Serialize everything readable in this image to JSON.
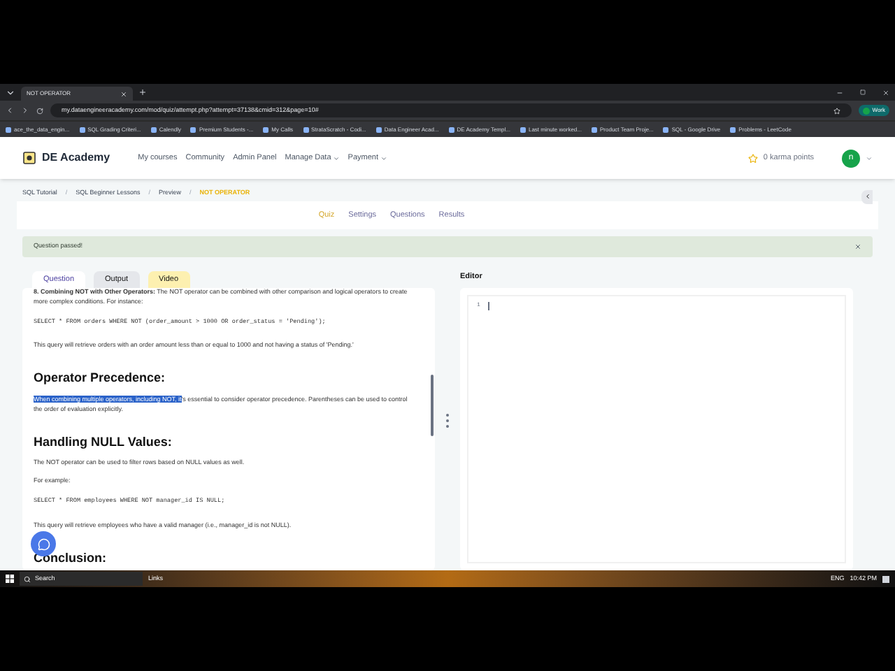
{
  "browser": {
    "tab_title": "NOT OPERATOR",
    "url": "my.dataengineeracademy.com/mod/quiz/attempt.php?attempt=37138&cmid=312&page=10#",
    "profile": "Work",
    "bookmarks": [
      "ace_the_data_engin...",
      "SQL Grading Criteri...",
      "Calendly",
      "Premium Students -...",
      "My Calls",
      "StrataScratch - Codi...",
      "Data Engineer Acad...",
      "DE Academy Templ...",
      "Last minute worked...",
      "Product Team Proje...",
      "SQL - Google Drive",
      "Problems - LeetCode"
    ]
  },
  "header": {
    "logo": "DE Academy",
    "nav": [
      {
        "label": "My courses",
        "menu": false
      },
      {
        "label": "Community",
        "menu": false
      },
      {
        "label": "Admin Panel",
        "menu": false
      },
      {
        "label": "Manage Data",
        "menu": true
      },
      {
        "label": "Payment",
        "menu": true
      }
    ],
    "karma": "0 karma points",
    "avatar": "n"
  },
  "breadcrumb": {
    "separator": "/",
    "items": [
      {
        "label": "SQL Tutorial",
        "current": false
      },
      {
        "label": "SQL Beginner Lessons",
        "current": false
      },
      {
        "label": "Preview",
        "current": false
      },
      {
        "label": "NOT OPERATOR",
        "current": true
      }
    ]
  },
  "quiz_tabs": [
    {
      "label": "Quiz",
      "selected": true
    },
    {
      "label": "Settings",
      "selected": false
    },
    {
      "label": "Questions",
      "selected": false
    },
    {
      "label": "Results",
      "selected": false
    }
  ],
  "alert": "Question passed!",
  "panel_tabs": [
    {
      "label": "Question",
      "selected": true,
      "color": "#ffffff"
    },
    {
      "label": "Output",
      "selected": false,
      "color": "#e5e7eb"
    },
    {
      "label": "Video",
      "selected": false,
      "color": "#fdf0b0"
    }
  ],
  "content": [
    {
      "kind": "para",
      "text": "**8. Combining NOT with Other Operators:** The NOT operator can be combined with other comparison and logical operators to create more complex conditions. For instance:"
    },
    {
      "kind": "code",
      "text": "SELECT * FROM orders WHERE NOT (order_amount > 1000 OR order_status = 'Pending');"
    },
    {
      "kind": "para",
      "text": "This query will retrieve orders with an order amount less than or equal to 1000 and not having a status of 'Pending.'"
    },
    {
      "kind": "heading",
      "text": "Operator Precedence:"
    },
    {
      "kind": "para",
      "selected_text": "When combining multiple operators, including NOT, it",
      "text": "'s essential to consider operator precedence. Parentheses can be used to control the order of evaluation explicitly."
    },
    {
      "kind": "heading",
      "text": "Handling NULL Values:"
    },
    {
      "kind": "para",
      "text": "The NOT operator can be used to filter rows based on NULL values as well."
    },
    {
      "kind": "para",
      "text": "For example:"
    },
    {
      "kind": "code",
      "text": "SELECT * FROM employees WHERE NOT manager_id IS NULL;"
    },
    {
      "kind": "para",
      "text": "This query will retrieve employees who have a valid manager (i.e., manager_id is not NULL)."
    },
    {
      "kind": "heading",
      "text": "Conclusion:"
    }
  ],
  "editor": {
    "title": "Editor",
    "line_numbers": [
      "1"
    ]
  },
  "taskbar": {
    "search": "Search",
    "links": "Links",
    "language": "ENG",
    "time": "10:42 PM"
  }
}
